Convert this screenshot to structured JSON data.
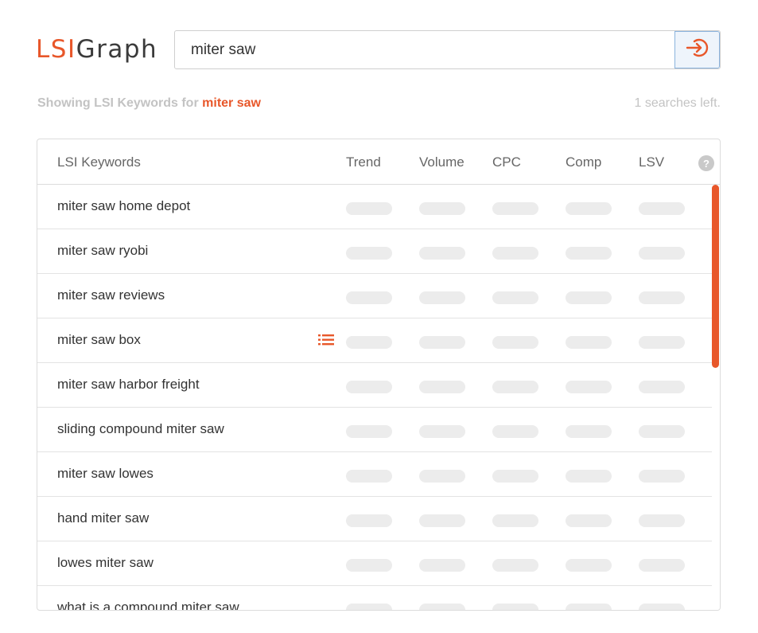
{
  "brand": {
    "lsi": "LSI",
    "graph": "Graph",
    "accent": "#e8572a"
  },
  "search": {
    "value": "miter saw",
    "button_icon": "enter-arrow-icon"
  },
  "status": {
    "showing_prefix": "Showing LSI Keywords for",
    "keyword": "miter saw",
    "searches_left": "1 searches left."
  },
  "table": {
    "headers": {
      "keyword": "LSI Keywords",
      "trend": "Trend",
      "volume": "Volume",
      "cpc": "CPC",
      "comp": "Comp",
      "lsv": "LSV",
      "help": "?"
    },
    "rows": [
      {
        "keyword": "miter saw home depot"
      },
      {
        "keyword": "miter saw ryobi"
      },
      {
        "keyword": "miter saw reviews"
      },
      {
        "keyword": "miter saw box",
        "list_icon": true
      },
      {
        "keyword": "miter saw harbor freight"
      },
      {
        "keyword": "sliding compound miter saw"
      },
      {
        "keyword": "miter saw lowes"
      },
      {
        "keyword": "hand miter saw"
      },
      {
        "keyword": "lowes miter saw"
      },
      {
        "keyword": "what is a compound miter saw"
      }
    ]
  }
}
